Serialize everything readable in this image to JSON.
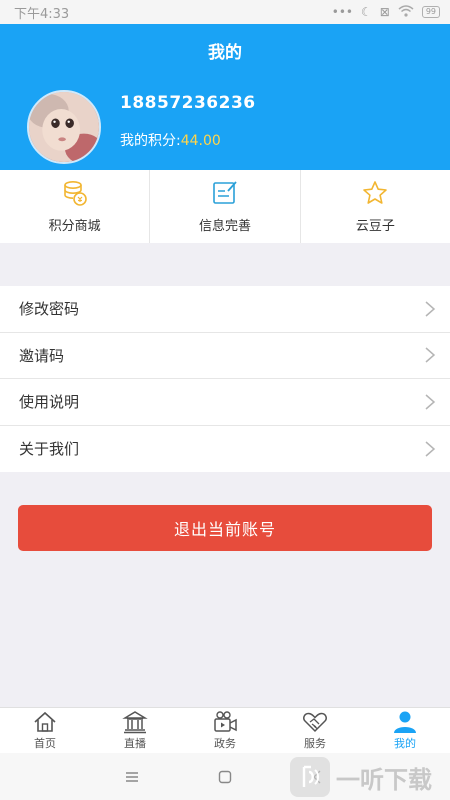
{
  "status_bar": {
    "time": "下午4:33",
    "battery": "99"
  },
  "header": {
    "title": "我的",
    "phone": "18857236236",
    "points_label": "我的积分:",
    "points_value": "44.00"
  },
  "quick_actions": [
    {
      "label": "积分商城",
      "icon": "coins-icon"
    },
    {
      "label": "信息完善",
      "icon": "edit-form-icon"
    },
    {
      "label": "云豆子",
      "icon": "star-icon"
    }
  ],
  "menu": [
    {
      "label": "修改密码"
    },
    {
      "label": "邀请码"
    },
    {
      "label": "使用说明"
    },
    {
      "label": "关于我们"
    }
  ],
  "logout_label": "退出当前账号",
  "tabs": [
    {
      "label": "首页",
      "icon": "home-icon"
    },
    {
      "label": "直播",
      "icon": "building-icon"
    },
    {
      "label": "政务",
      "icon": "video-camera-icon"
    },
    {
      "label": "服务",
      "icon": "handshake-icon"
    },
    {
      "label": "我的",
      "icon": "user-icon",
      "active": true
    }
  ],
  "watermark": {
    "text": "一听下载"
  },
  "colors": {
    "primary": "#1aa3f5",
    "logout": "#e74c3c",
    "points": "#ffd54a"
  }
}
